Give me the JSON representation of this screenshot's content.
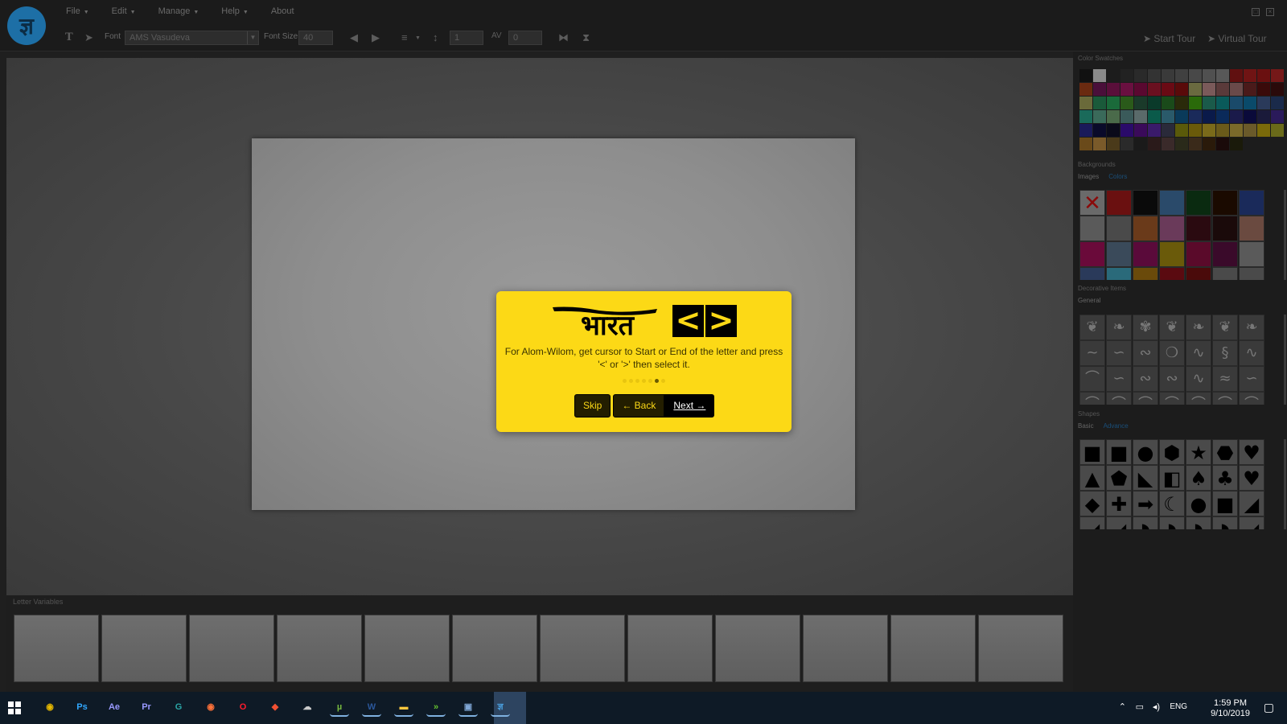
{
  "menubar": {
    "items": [
      {
        "label": "File",
        "has_caret": true
      },
      {
        "label": "Edit",
        "has_caret": true
      },
      {
        "label": "Manage",
        "has_caret": true
      },
      {
        "label": "Help",
        "has_caret": true
      },
      {
        "label": "About",
        "has_caret": false
      }
    ],
    "logo_glyph": "ज्ञ"
  },
  "toolbar": {
    "font_label": "Font",
    "font_value": "AMS Vasudeva",
    "font_size_label": "Font Size",
    "font_size_value": "40",
    "line_height_value": "1",
    "letter_spacing_value": "0",
    "start_tour": "Start Tour",
    "virtual_tour": "Virtual Tour"
  },
  "tour": {
    "logo_text": "भारत",
    "key_left": "<",
    "key_right": ">",
    "message": "For Alom-Wilom, get cursor to Start or End of the letter and press '<' or '>' then select it.",
    "dots_total": 7,
    "dots_active_index": 5,
    "skip": "Skip",
    "back": "← Back",
    "next": "Next →",
    "color": "#fcd916"
  },
  "letter_variables": {
    "title": "Letter Variables",
    "slot_count": 12
  },
  "right_panel": {
    "color_swatches_title": "Color Swatches",
    "swatches": [
      "#111111",
      "#8a8a8a",
      "#1c1c1c",
      "#222222",
      "#2a2a2a",
      "#333333",
      "#3a3a3a",
      "#404040",
      "#484848",
      "#505050",
      "#585858",
      "#601010",
      "#701414",
      "#6a1010",
      "#751818",
      "#6a2a10",
      "#4a0f3a",
      "#5a0f3a",
      "#6a1040",
      "#5a0830",
      "#6a1020",
      "#6a0a14",
      "#5a0a0a",
      "#6a6a40",
      "#7a5a5a",
      "#5a3a3a",
      "#6a4a4a",
      "#4a1a1a",
      "#3a0a0a",
      "#2a0a0a",
      "#6a6a3a",
      "#1a5a3a",
      "#1a6a3a",
      "#2a5a1a",
      "#1a3a2a",
      "#0a3a2a",
      "#1a4a1a",
      "#2a2a0a",
      "#2a6a0a",
      "#1a5a4a",
      "#0a5a5a",
      "#1a4a6a",
      "#0a4a6a",
      "#2a3a5a",
      "#1a2a4a",
      "#1a6a5a",
      "#3a6a5a",
      "#4a6a4a",
      "#3a5a5a",
      "#5a6a6a",
      "#0a5a4a",
      "#2a5a6a",
      "#0a3a5a",
      "#1a2a5a",
      "#0a1a4a",
      "#0a2a5a",
      "#1a1a4a",
      "#0a0a3a",
      "#1a1a3a",
      "#2a1a5a",
      "#1a1a5a",
      "#0a0a2a",
      "#0a0a1a",
      "#2a0a6a",
      "#3a0a5a",
      "#3a1a6a",
      "#2a2a3a",
      "#5a5a0a",
      "#6a5a0a",
      "#7a6a1a",
      "#6a5a1a",
      "#7a6a2a",
      "#6a5a2a",
      "#7a6a0a",
      "#6a6a1a",
      "#6a4a1a",
      "#7a5a2a",
      "#4a3a1a",
      "#2a2a2a",
      "#1a1a1a",
      "#2a1a1a",
      "#3a2a2a",
      "#2a2a1a",
      "#3a2a1a",
      "#2a1a0a",
      "#1a0a0a",
      "#1a1a0a"
    ],
    "backgrounds_title": "Backgrounds",
    "backgrounds_tabs": [
      "Images",
      "Colors"
    ],
    "background_tiles": [
      "#5a2020",
      "#6a1010",
      "#0a0a0a",
      "#2a4a6a",
      "#0a2a10",
      "#1a0a00",
      "#1a2a5a",
      "#5a5a5a",
      "#4a4a4a",
      "#6a3a1a",
      "#6a3a5a",
      "#2a0a10",
      "#1a0a0a",
      "#6a4a40",
      "#6a0a3a",
      "#3a4a5a",
      "#5a0a3a",
      "#6a5a0a",
      "#5a0a2a",
      "#3a0a2a",
      "#5a5a5a",
      "#2a3a5a",
      "#2a6a7a",
      "#6a4a0a",
      "#5a0a10",
      "#4a0a0a",
      "#4a4a4a",
      "#4a4a4a"
    ],
    "decorative_title": "Decorative Items",
    "decorative_tabs": [
      "General"
    ],
    "decorative_glyphs": [
      "❦",
      "❧",
      "✾",
      "❦",
      "❧",
      "❦",
      "❧",
      "~",
      "∽",
      "∾",
      "❍",
      "∿",
      "§",
      "∿",
      "⌒",
      "∽",
      "∾",
      "∾",
      "∿",
      "≈",
      "∽",
      "⌒",
      "⌒",
      "⌒",
      "⌒",
      "⌒",
      "⌒",
      "⌒"
    ],
    "shapes_title": "Shapes",
    "shapes_tabs": [
      "Basic",
      "Advance"
    ],
    "shape_glyphs": [
      "■",
      "■",
      "●",
      "⬢",
      "★",
      "⬣",
      "♥",
      "▲",
      "⬟",
      "◣",
      "◧",
      "♠",
      "♣",
      "♥",
      "◆",
      "✚",
      "➡",
      "☾",
      "●",
      "■",
      "◢",
      "◢",
      "◢",
      "◗",
      "◗",
      "◗",
      "◗",
      "◢"
    ]
  },
  "taskbar": {
    "apps": [
      {
        "name": "chrome",
        "glyph": "◉",
        "color": "#e6b800"
      },
      {
        "name": "photoshop",
        "glyph": "Ps",
        "color": "#31a8ff"
      },
      {
        "name": "after-effects",
        "glyph": "Ae",
        "color": "#9999ff"
      },
      {
        "name": "premiere",
        "glyph": "Pr",
        "color": "#9999ff"
      },
      {
        "name": "greenshot",
        "glyph": "G",
        "color": "#2aa6a6"
      },
      {
        "name": "firefox",
        "glyph": "◉",
        "color": "#ff7139"
      },
      {
        "name": "opera",
        "glyph": "O",
        "color": "#ff1b2d"
      },
      {
        "name": "git",
        "glyph": "◆",
        "color": "#f05033"
      },
      {
        "name": "app-cloud",
        "glyph": "☁",
        "color": "#cccccc"
      },
      {
        "name": "utorrent",
        "glyph": "µ",
        "color": "#76b83f"
      },
      {
        "name": "word",
        "glyph": "W",
        "color": "#2b579a"
      },
      {
        "name": "file-explorer",
        "glyph": "▬",
        "color": "#ffc83d"
      },
      {
        "name": "app-chevron",
        "glyph": "»",
        "color": "#65c330"
      },
      {
        "name": "app-photos",
        "glyph": "▣",
        "color": "#7fa7d6"
      },
      {
        "name": "app-bharat",
        "glyph": "ज्ञ",
        "color": "#4aa0e0"
      }
    ],
    "language": "ENG",
    "time": "1:59 PM",
    "date": "9/10/2019"
  }
}
